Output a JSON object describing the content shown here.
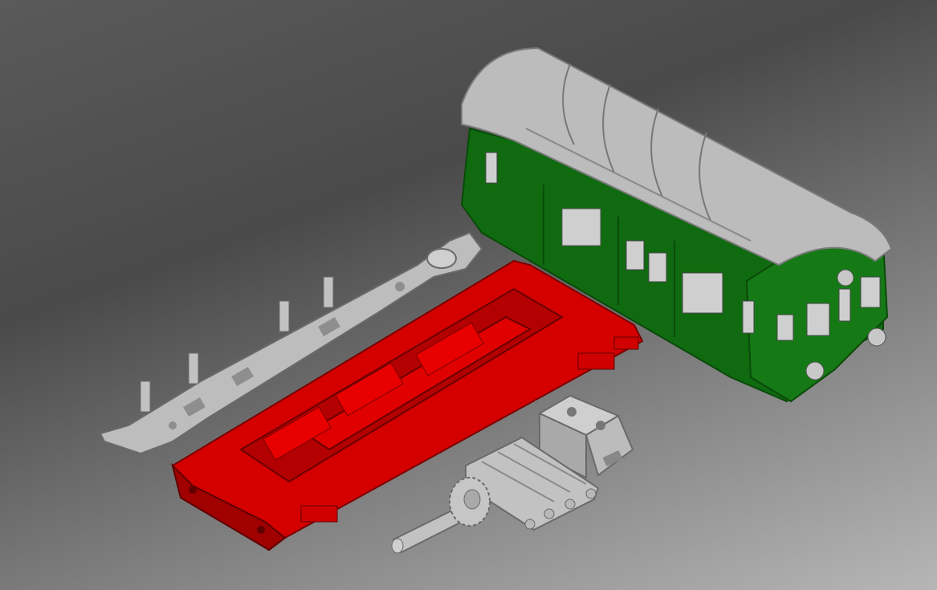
{
  "viewport": {
    "background_top": "#4c4c4c",
    "background_bottom": "#b6b6b6"
  },
  "parts": [
    {
      "name": "coach-body",
      "colors": {
        "body": "#0f6b0f",
        "roof": "#bdbdbd"
      }
    },
    {
      "name": "chassis-frame",
      "color": "#d40000"
    },
    {
      "name": "underframe-beam",
      "color": "#bdbdbd"
    },
    {
      "name": "gear-axle",
      "color": "#bdbdbd"
    },
    {
      "name": "motor-mount-block",
      "color": "#bdbdbd"
    },
    {
      "name": "gear-bracket",
      "color": "#bdbdbd"
    }
  ]
}
